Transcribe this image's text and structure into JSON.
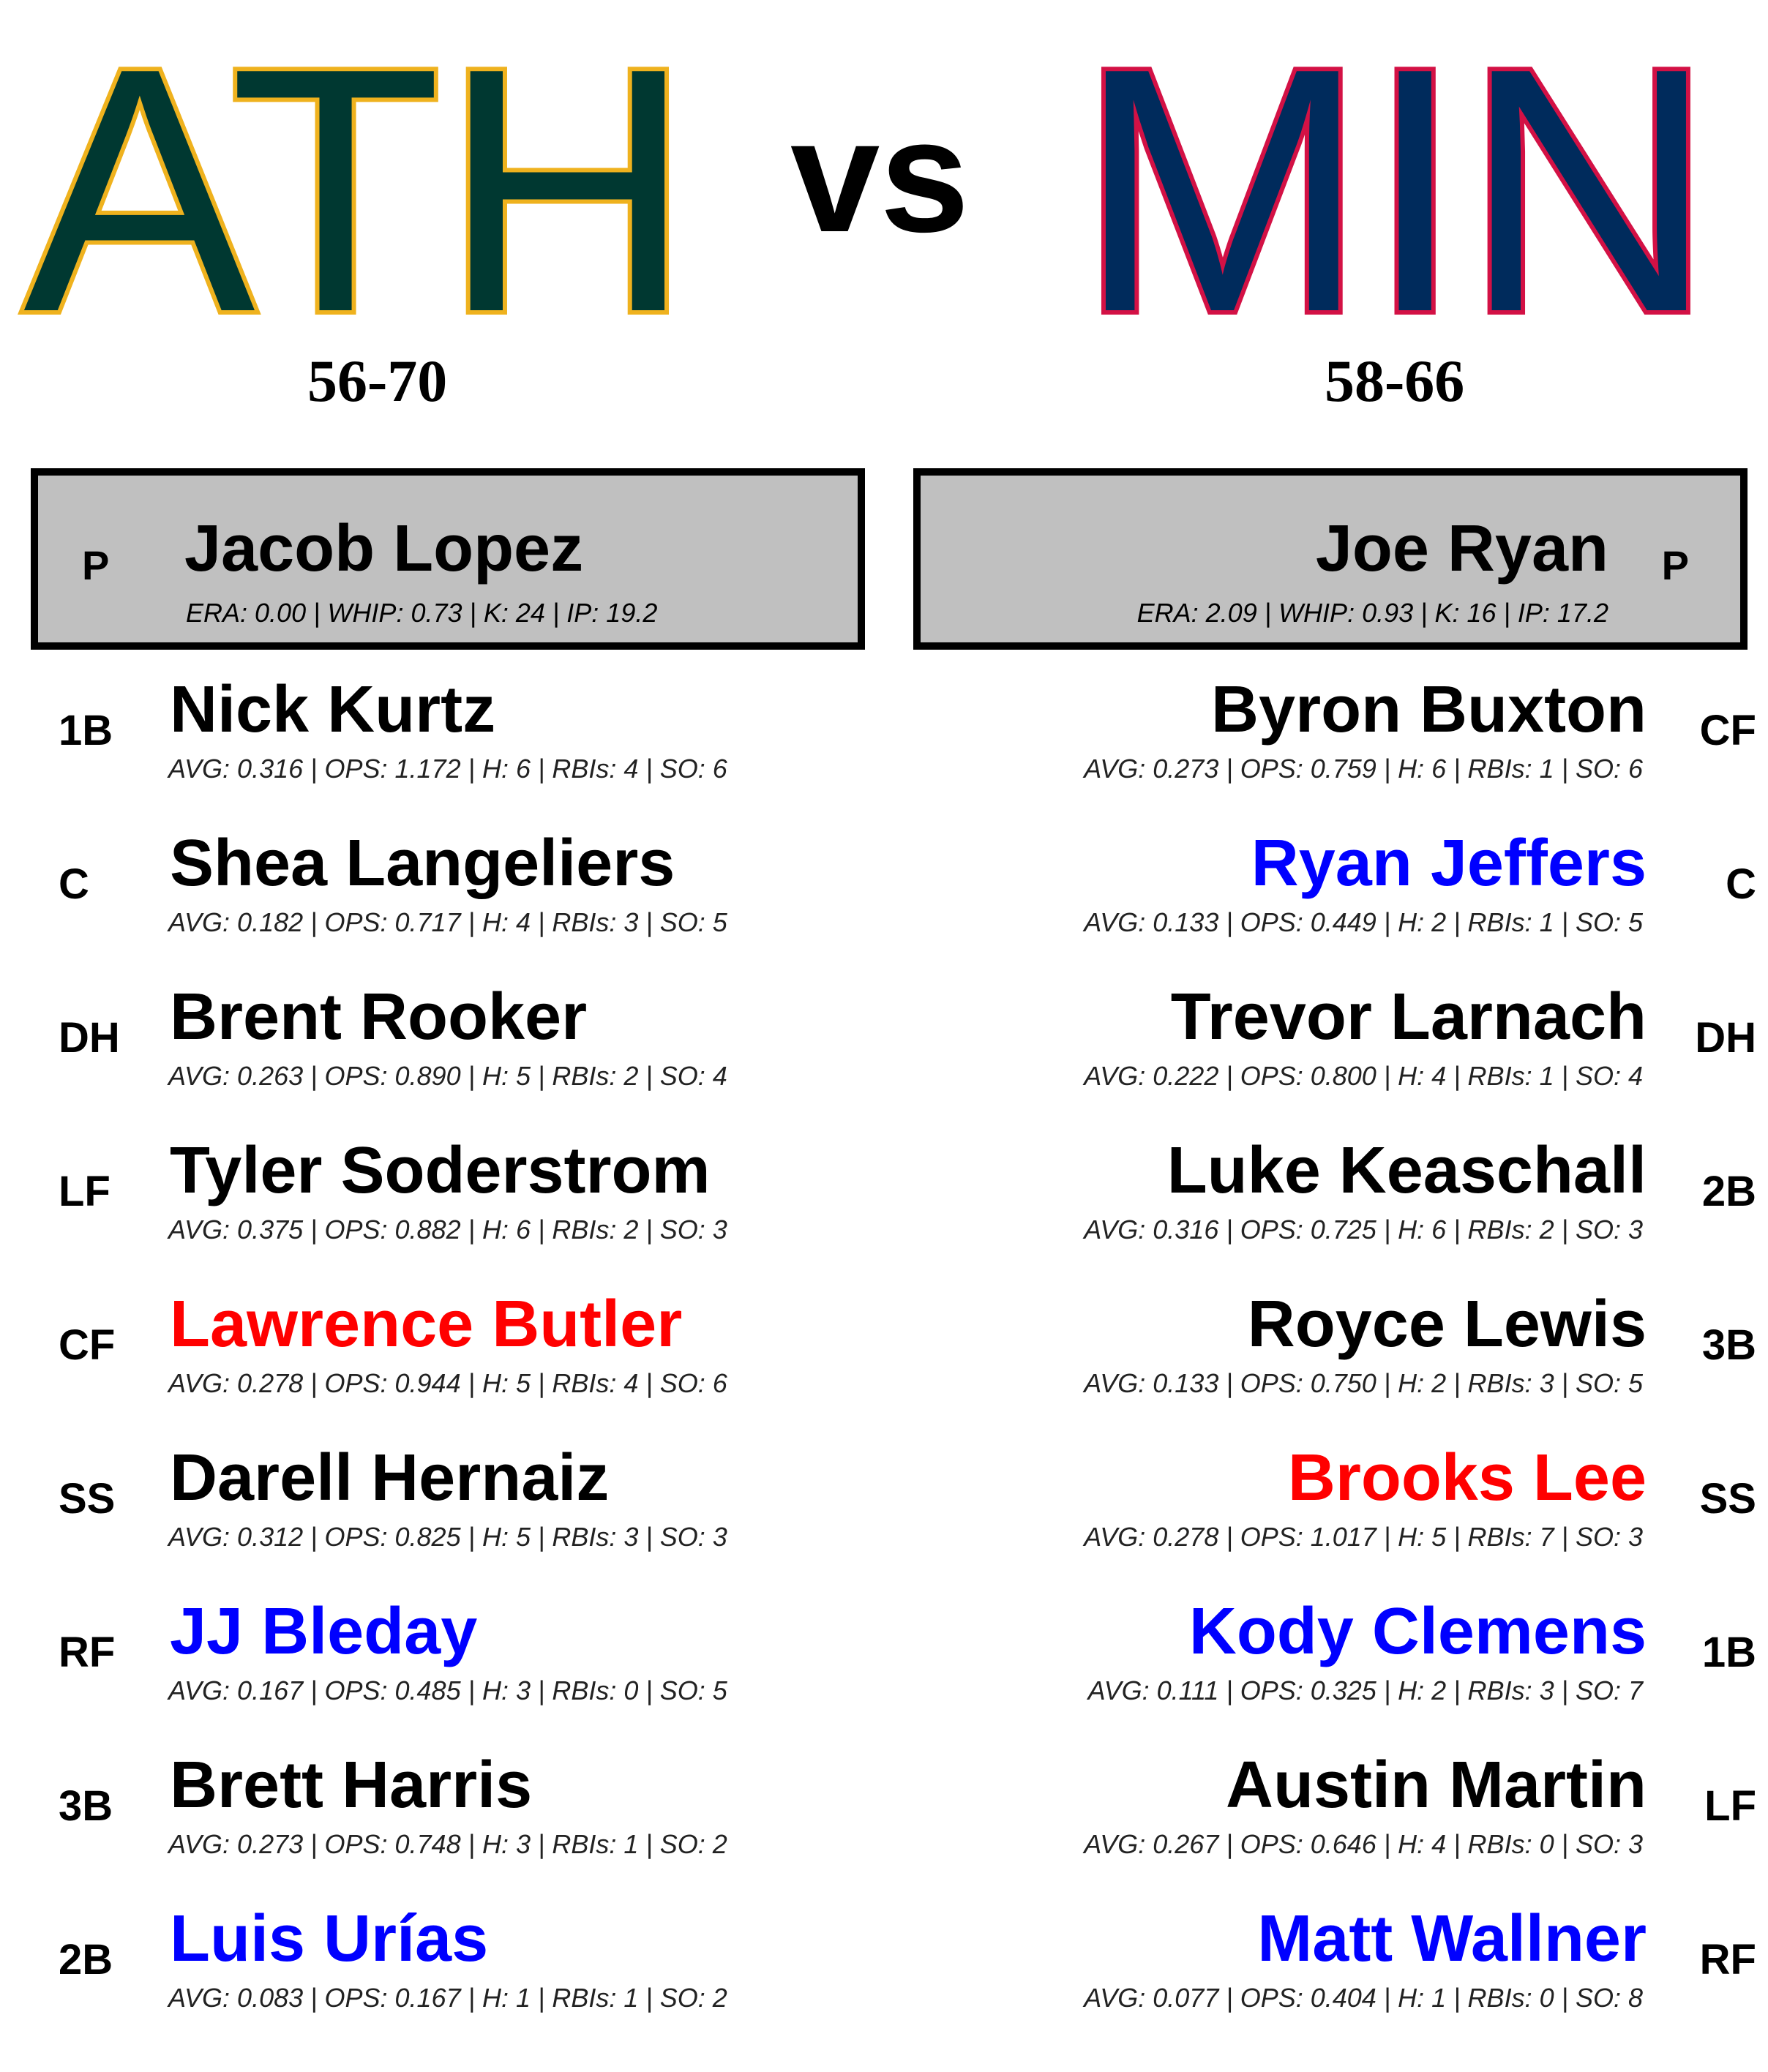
{
  "header": {
    "away_abbr": "ATH",
    "vs": "vs",
    "home_abbr": "MIN",
    "away_record": "56-70",
    "home_record": "58-66"
  },
  "colors": {
    "ath_fill": "#003831",
    "ath_stroke": "#EFB21E",
    "min_fill": "#002B5C",
    "min_stroke": "#D31145",
    "normal": "#000000",
    "red": "#FF0000",
    "blue": "#0000FF"
  },
  "away": {
    "pitcher": {
      "pos": "P",
      "name": "Jacob Lopez",
      "stats": "ERA: 0.00 | WHIP: 0.73 | K: 24 | IP: 19.2"
    },
    "lineup": [
      {
        "pos": "1B",
        "name": "Nick Kurtz",
        "stats": "AVG: 0.316 | OPS: 1.172 | H: 6 | RBIs: 4 | SO: 6",
        "color": "#000000"
      },
      {
        "pos": "C",
        "name": "Shea Langeliers",
        "stats": "AVG: 0.182 | OPS: 0.717 | H: 4 | RBIs: 3 | SO: 5",
        "color": "#000000"
      },
      {
        "pos": "DH",
        "name": "Brent Rooker",
        "stats": "AVG: 0.263 | OPS: 0.890 | H: 5 | RBIs: 2 | SO: 4",
        "color": "#000000"
      },
      {
        "pos": "LF",
        "name": "Tyler Soderstrom",
        "stats": "AVG: 0.375 | OPS: 0.882 | H: 6 | RBIs: 2 | SO: 3",
        "color": "#000000"
      },
      {
        "pos": "CF",
        "name": "Lawrence Butler",
        "stats": "AVG: 0.278 | OPS: 0.944 | H: 5 | RBIs: 4 | SO: 6",
        "color": "#FF0000"
      },
      {
        "pos": "SS",
        "name": "Darell Hernaiz",
        "stats": "AVG: 0.312 | OPS: 0.825 | H: 5 | RBIs: 3 | SO: 3",
        "color": "#000000"
      },
      {
        "pos": "RF",
        "name": "JJ Bleday",
        "stats": "AVG: 0.167 | OPS: 0.485 | H: 3 | RBIs: 0 | SO: 5",
        "color": "#0000FF"
      },
      {
        "pos": "3B",
        "name": "Brett Harris",
        "stats": "AVG: 0.273 | OPS: 0.748 | H: 3 | RBIs: 1 | SO: 2",
        "color": "#000000"
      },
      {
        "pos": "2B",
        "name": "Luis Urías",
        "stats": "AVG: 0.083 | OPS: 0.167 | H: 1 | RBIs: 1 | SO: 2",
        "color": "#0000FF"
      }
    ]
  },
  "home": {
    "pitcher": {
      "pos": "P",
      "name": "Joe Ryan",
      "stats": "ERA: 2.09 | WHIP: 0.93 | K: 16 | IP: 17.2"
    },
    "lineup": [
      {
        "pos": "CF",
        "name": "Byron Buxton",
        "stats": "AVG: 0.273 | OPS: 0.759 | H: 6 | RBIs: 1 | SO: 6",
        "color": "#000000"
      },
      {
        "pos": "C",
        "name": "Ryan Jeffers",
        "stats": "AVG: 0.133 | OPS: 0.449 | H: 2 | RBIs: 1 | SO: 5",
        "color": "#0000FF"
      },
      {
        "pos": "DH",
        "name": "Trevor Larnach",
        "stats": "AVG: 0.222 | OPS: 0.800 | H: 4 | RBIs: 1 | SO: 4",
        "color": "#000000"
      },
      {
        "pos": "2B",
        "name": "Luke Keaschall",
        "stats": "AVG: 0.316 | OPS: 0.725 | H: 6 | RBIs: 2 | SO: 3",
        "color": "#000000"
      },
      {
        "pos": "3B",
        "name": "Royce Lewis",
        "stats": "AVG: 0.133 | OPS: 0.750 | H: 2 | RBIs: 3 | SO: 5",
        "color": "#000000"
      },
      {
        "pos": "SS",
        "name": "Brooks Lee",
        "stats": "AVG: 0.278 | OPS: 1.017 | H: 5 | RBIs: 7 | SO: 3",
        "color": "#FF0000"
      },
      {
        "pos": "1B",
        "name": "Kody Clemens",
        "stats": "AVG: 0.111 | OPS: 0.325 | H: 2 | RBIs: 3 | SO: 7",
        "color": "#0000FF"
      },
      {
        "pos": "LF",
        "name": "Austin Martin",
        "stats": "AVG: 0.267 | OPS: 0.646 | H: 4 | RBIs: 0 | SO: 3",
        "color": "#000000"
      },
      {
        "pos": "RF",
        "name": "Matt Wallner",
        "stats": "AVG: 0.077 | OPS: 0.404 | H: 1 | RBIs: 0 | SO: 8",
        "color": "#0000FF"
      }
    ]
  }
}
